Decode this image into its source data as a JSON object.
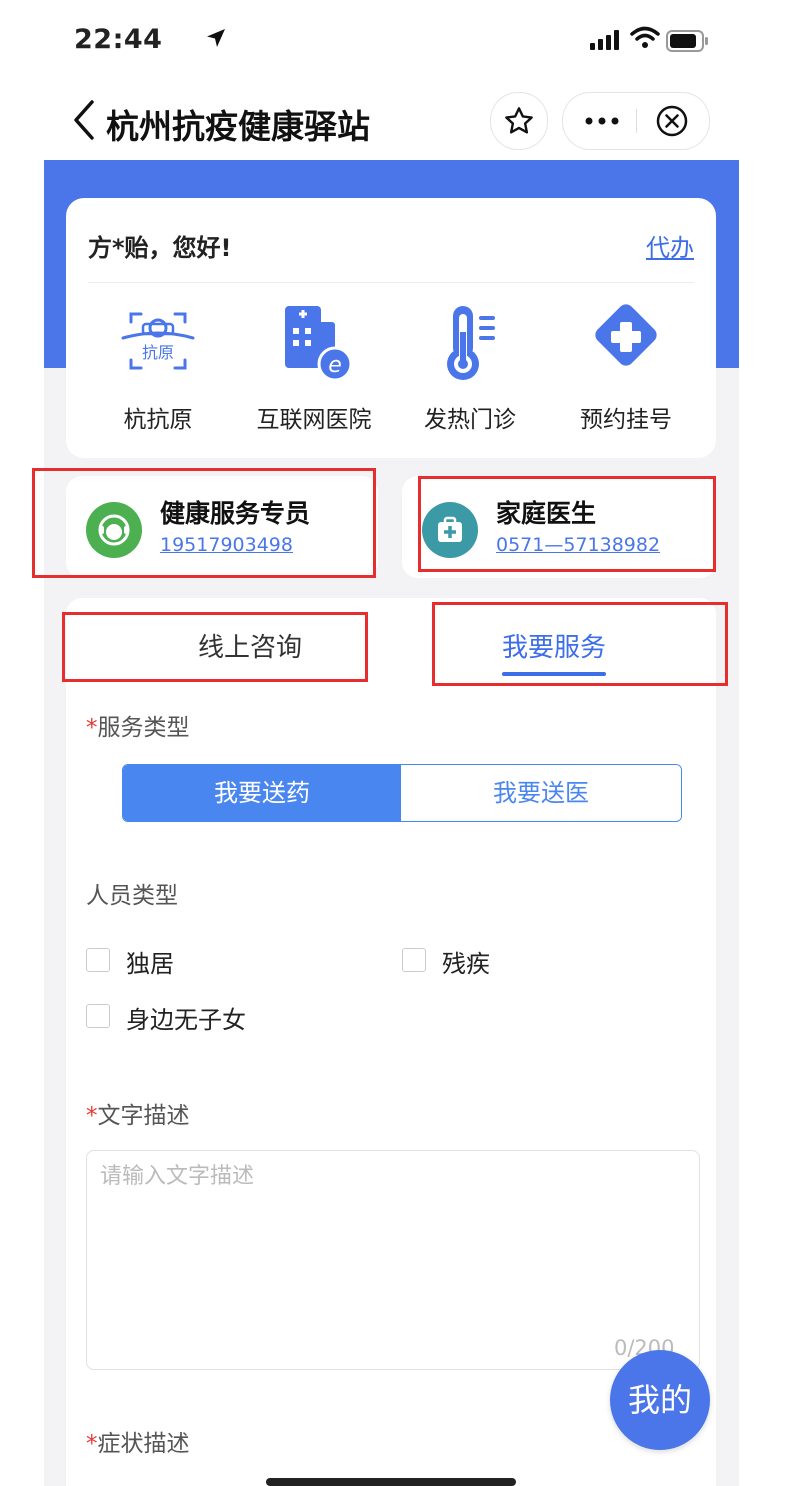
{
  "status_bar": {
    "time": "22:44"
  },
  "nav": {
    "title": "杭州抗疫健康驿站"
  },
  "header": {
    "greeting": "方*贻，您好!",
    "action": "代办",
    "services": [
      {
        "label": "杭抗原",
        "icon": "antigen-test-icon",
        "icon_text": "抗原"
      },
      {
        "label": "互联网医院",
        "icon": "internet-hospital-icon",
        "icon_text": "e"
      },
      {
        "label": "发热门诊",
        "icon": "thermometer-icon"
      },
      {
        "label": "预约挂号",
        "icon": "medical-cross-icon"
      }
    ]
  },
  "contacts": [
    {
      "title": "健康服务专员",
      "phone": "19517903498",
      "icon": "customer-service-icon",
      "color": "#4caf50"
    },
    {
      "title": "家庭医生",
      "phone": "0571—57138982",
      "icon": "medical-kit-icon",
      "color": "#3c9aa6"
    }
  ],
  "tabs": [
    {
      "label": "线上咨询",
      "active": false
    },
    {
      "label": "我要服务",
      "active": true
    }
  ],
  "form": {
    "service_type": {
      "required_mark": "*",
      "label": "服务类型",
      "options": [
        {
          "label": "我要送药",
          "selected": true
        },
        {
          "label": "我要送医",
          "selected": false
        }
      ]
    },
    "person_type": {
      "label": "人员类型",
      "options": [
        {
          "label": "独居",
          "checked": false
        },
        {
          "label": "残疾",
          "checked": false
        },
        {
          "label": "身边无子女",
          "checked": false
        }
      ]
    },
    "text_desc": {
      "required_mark": "*",
      "label": "文字描述",
      "placeholder": "请输入文字描述",
      "value": "",
      "counter": "0/200"
    },
    "symptom_desc": {
      "required_mark": "*",
      "label": "症状描述"
    }
  },
  "fab": {
    "label": "我的"
  },
  "colors": {
    "primary": "#4a76ea",
    "segment": "#4a86f0",
    "required": "#e53935",
    "highlight_box": "#e62e2e"
  }
}
